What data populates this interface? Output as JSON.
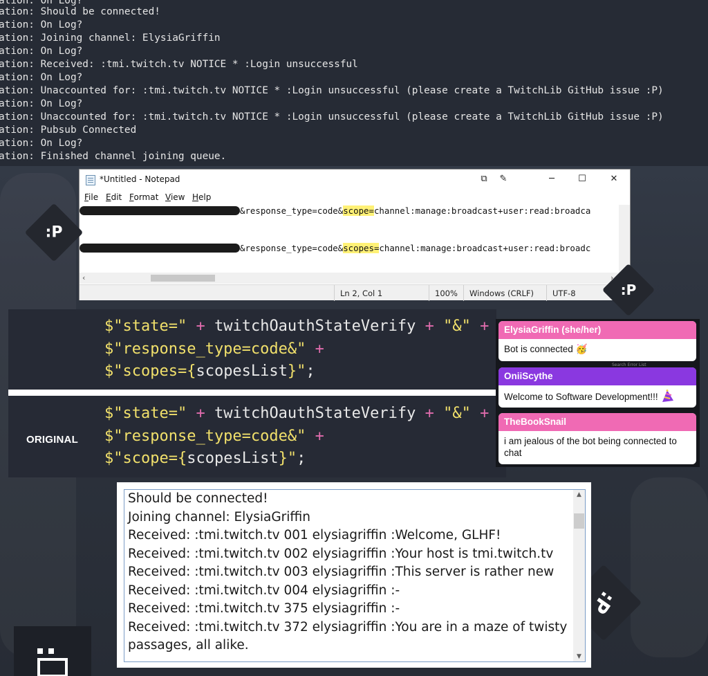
{
  "console": {
    "lines": [
      "ormation: On Log?",
      "ormation: Should be connected!",
      "ormation: On Log?",
      "ormation: Joining channel: ElysiaGriffin",
      "ormation: On Log?",
      "ormation: Received: :tmi.twitch.tv NOTICE * :Login unsuccessful",
      "ormation: On Log?",
      "ormation: Unaccounted for: :tmi.twitch.tv NOTICE * :Login unsuccessful (please create a TwitchLib GitHub issue :P)",
      "ormation: On Log?",
      "ormation: Unaccounted for: :tmi.twitch.tv NOTICE * :Login unsuccessful (please create a TwitchLib GitHub issue :P)",
      "ormation: Pubsub Connected",
      "ormation: On Log?",
      "ormation: Finished channel joining queue."
    ]
  },
  "notepad": {
    "title": "*Untitled - Notepad",
    "menu": [
      "File",
      "Edit",
      "Format",
      "View",
      "Help"
    ],
    "line1": {
      "pre": "&response_type=code&",
      "highlight": "scope=",
      "post": "channel:manage:broadcast+user:read:broadca"
    },
    "line2": {
      "pre": "&response_type=code&",
      "highlight": "scopes=",
      "post": "channel:manage:broadcast+user:read:broadc"
    },
    "status": {
      "position": "Ln 2, Col 1",
      "zoom": "100%",
      "eol": "Windows (CRLF)",
      "encoding": "UTF-8"
    }
  },
  "code_fixed": {
    "l1": {
      "s1": "$\"state=\"",
      "op1": " + ",
      "id": "twitchOauthStateVerify",
      "op2": " + ",
      "s2": "\"&\"",
      "op3": " +"
    },
    "l2": {
      "s1": "$\"response_type=code&\"",
      "op1": " +"
    },
    "l3": {
      "s1": "$\"scopes={",
      "id": "scopesList",
      "s2": "}\"",
      "end": ";"
    }
  },
  "code_original": {
    "label": "ORIGINAL",
    "l1": {
      "s1": "$\"state=\"",
      "op1": " + ",
      "id": "twitchOauthStateVerify",
      "op2": " + ",
      "s2": "\"&\"",
      "op3": " +"
    },
    "l2": {
      "s1": "$\"response_type=code&\"",
      "op1": " +"
    },
    "l3": {
      "s1": "$\"scope={",
      "id": "scopesList",
      "s2": "}\"",
      "end": ";"
    }
  },
  "chat": {
    "faint_text": "Search Error List",
    "messages": [
      {
        "name": "ElysiaGriffin (she/her)",
        "text": "Bot is connected",
        "emoji": "🥳",
        "color": "#f06ab4"
      },
      {
        "name": "OniiScythe",
        "text": "Welcome to Software Development!!!",
        "emoji": "party-hat-icon",
        "color": "#8a38e0"
      },
      {
        "name": "TheBookSnail",
        "text": "i am jealous of the bot being connected to chat",
        "emoji": "",
        "color": "#f06ab4"
      }
    ]
  },
  "log": {
    "lines": [
      "Should be connected!",
      "Joining channel: ElysiaGriffin",
      "Received: :tmi.twitch.tv 001 elysiagriffin :Welcome, GLHF!",
      "Received: :tmi.twitch.tv 002 elysiagriffin :Your host is tmi.twitch.tv",
      "Received: :tmi.twitch.tv 003 elysiagriffin :This server is rather new",
      "Received: :tmi.twitch.tv 004 elysiagriffin :-",
      "Received: :tmi.twitch.tv 375 elysiagriffin :-",
      "Received: :tmi.twitch.tv 372 elysiagriffin :You are in a maze of twisty",
      "passages, all alike."
    ]
  },
  "stickers": {
    "face": ":P"
  }
}
